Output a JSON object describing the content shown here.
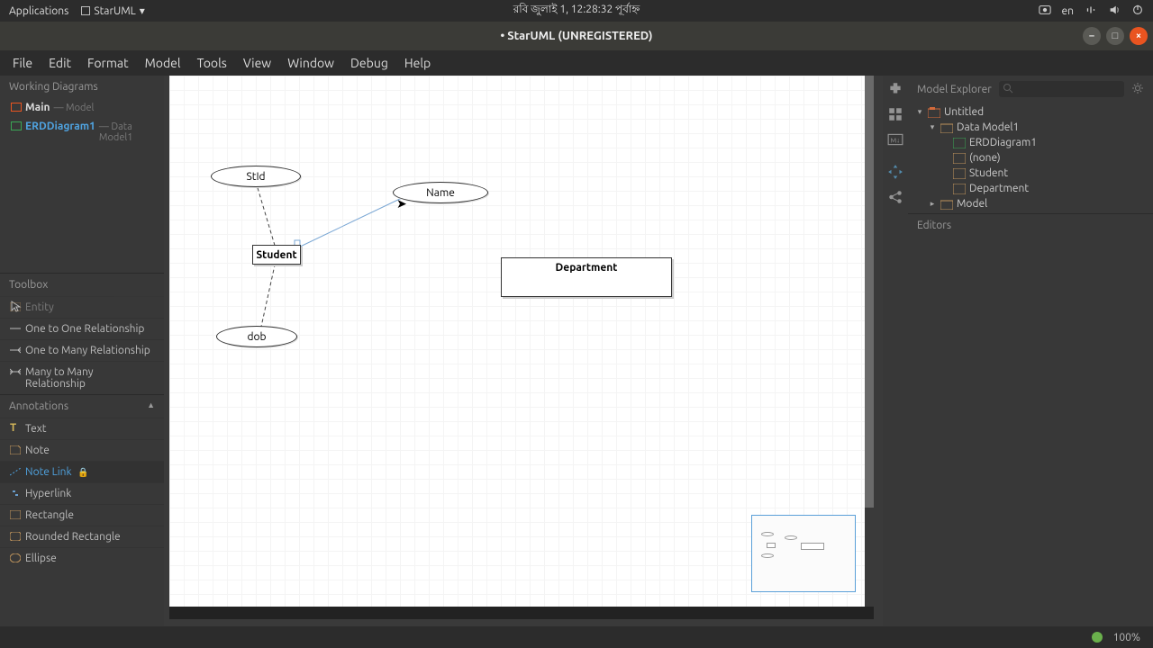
{
  "system": {
    "applications": "Applications",
    "appname": "StarUML",
    "clock": "রবি জুলাই  1, 12:28:32 পূর্বাহ্ন",
    "lang": "en"
  },
  "window": {
    "title": "• StarUML (UNREGISTERED)"
  },
  "menubar": [
    "File",
    "Edit",
    "Format",
    "Model",
    "Tools",
    "View",
    "Window",
    "Debug",
    "Help"
  ],
  "leftpanel": {
    "working_diagrams_header": "Working Diagrams",
    "diagrams": [
      {
        "name": "Main",
        "model": "— Model",
        "sel": false,
        "kind": "main"
      },
      {
        "name": "ERDDiagram1",
        "model": "— Data Model1",
        "sel": true,
        "kind": "erd"
      }
    ],
    "toolbox_header": "Toolbox",
    "tool_items_top": [
      "Entity",
      "One to One Relationship",
      "One to Many Relationship",
      "Many to Many Relationship"
    ],
    "annotations_header": "Annotations",
    "annotations": [
      "Text",
      "Note",
      "Note Link",
      "Hyperlink",
      "Rectangle",
      "Rounded Rectangle",
      "Ellipse"
    ],
    "annotation_selected": "Note Link"
  },
  "canvas": {
    "shapes": {
      "stid": "StId",
      "name": "Name",
      "student": "Student",
      "dob": "dob",
      "department": "Department"
    }
  },
  "explorer": {
    "header": "Model Explorer",
    "tree": {
      "root": "Untitled",
      "dm": "Data Model1",
      "erd": "ERDDiagram1",
      "none": "(none)",
      "student": "Student",
      "department": "Department",
      "model": "Model"
    },
    "editors_header": "Editors"
  },
  "status": {
    "zoom": "100%"
  }
}
